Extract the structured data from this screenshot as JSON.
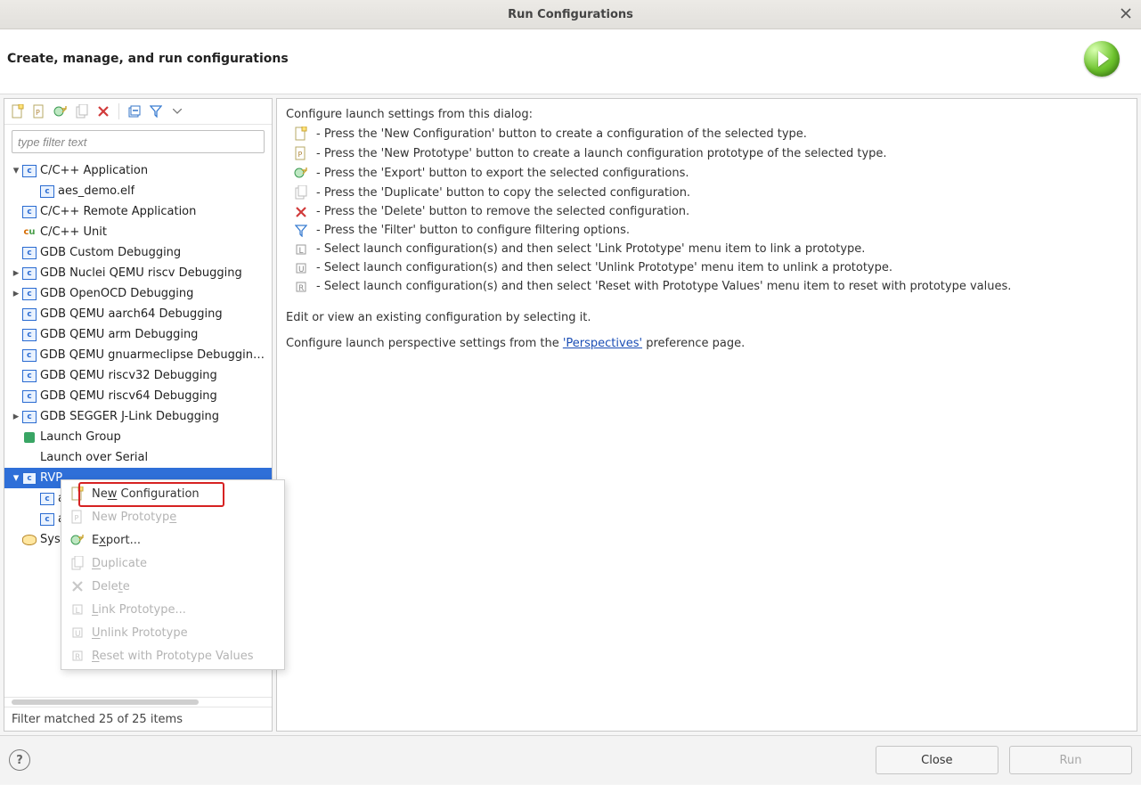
{
  "window": {
    "title": "Run Configurations"
  },
  "header": {
    "heading": "Create, manage, and run configurations"
  },
  "filter": {
    "placeholder": "type filter text"
  },
  "tree": {
    "items": [
      {
        "label": "C/C++ Application",
        "caret": "down",
        "icon": "c"
      },
      {
        "label": "aes_demo.elf",
        "indent": 1,
        "caret": "none",
        "icon": "c"
      },
      {
        "label": "C/C++ Remote Application",
        "caret": "none",
        "icon": "c"
      },
      {
        "label": "C/C++ Unit",
        "caret": "none",
        "icon": "cu"
      },
      {
        "label": "GDB Custom Debugging",
        "caret": "none",
        "icon": "c"
      },
      {
        "label": "GDB Nuclei QEMU riscv Debugging",
        "caret": "right",
        "icon": "c"
      },
      {
        "label": "GDB OpenOCD Debugging",
        "caret": "right",
        "icon": "c"
      },
      {
        "label": "GDB QEMU aarch64 Debugging",
        "caret": "none",
        "icon": "c"
      },
      {
        "label": "GDB QEMU arm Debugging",
        "caret": "none",
        "icon": "c"
      },
      {
        "label": "GDB QEMU gnuarmeclipse Debugging (D",
        "caret": "none",
        "icon": "c"
      },
      {
        "label": "GDB QEMU riscv32 Debugging",
        "caret": "none",
        "icon": "c"
      },
      {
        "label": "GDB QEMU riscv64 Debugging",
        "caret": "none",
        "icon": "c"
      },
      {
        "label": "GDB SEGGER J-Link Debugging",
        "caret": "right",
        "icon": "c"
      },
      {
        "label": "Launch Group",
        "caret": "none",
        "icon": "lg"
      },
      {
        "label": "Launch over Serial",
        "caret": "none",
        "icon": "none"
      },
      {
        "label": "RVP",
        "caret": "down",
        "icon": "c",
        "selected": true
      },
      {
        "label": "a",
        "indent": 1,
        "caret": "none",
        "icon": "c"
      },
      {
        "label": "a",
        "indent": 1,
        "caret": "none",
        "icon": "c"
      },
      {
        "label": "Syst",
        "caret": "none",
        "icon": "db"
      }
    ]
  },
  "status": {
    "text": "Filter matched 25 of 25 items"
  },
  "main": {
    "intro": "Configure launch settings from this dialog:",
    "hints": [
      {
        "icon": "new",
        "text": " - Press the 'New Configuration' button to create a configuration of the selected type."
      },
      {
        "icon": "proto",
        "text": " - Press the 'New Prototype' button to create a launch configuration prototype of the selected type."
      },
      {
        "icon": "export",
        "text": " - Press the 'Export' button to export the selected configurations."
      },
      {
        "icon": "duplicate",
        "text": " - Press the 'Duplicate' button to copy the selected configuration."
      },
      {
        "icon": "delete",
        "text": " - Press the 'Delete' button to remove the selected configuration."
      },
      {
        "icon": "filter",
        "text": " - Press the 'Filter' button to configure filtering options."
      },
      {
        "icon": "link",
        "text": " - Select launch configuration(s) and then select 'Link Prototype' menu item to link a prototype."
      },
      {
        "icon": "unlink",
        "text": " - Select launch configuration(s) and then select 'Unlink Prototype' menu item to unlink a prototype."
      },
      {
        "icon": "reset",
        "text": " - Select launch configuration(s) and then select 'Reset with Prototype Values' menu item to reset with prototype values."
      }
    ],
    "edit_line": "Edit or view an existing configuration by selecting it.",
    "persp_prefix": "Configure launch perspective settings from the ",
    "persp_link": "'Perspectives'",
    "persp_suffix": " preference page."
  },
  "context_menu": {
    "items": [
      {
        "key": "new_config",
        "pre": "Ne",
        "u": "w",
        "post": " Configuration",
        "icon": "new",
        "enabled": true,
        "highlight": true
      },
      {
        "key": "new_proto",
        "pre": "New Prototyp",
        "u": "e",
        "post": "",
        "icon": "proto",
        "enabled": false
      },
      {
        "key": "export",
        "pre": "E",
        "u": "x",
        "post": "port...",
        "icon": "export",
        "enabled": true
      },
      {
        "key": "duplicate",
        "pre": "",
        "u": "D",
        "post": "uplicate",
        "icon": "duplicate",
        "enabled": false
      },
      {
        "key": "delete",
        "pre": "Dele",
        "u": "t",
        "post": "e",
        "icon": "delete",
        "enabled": false
      },
      {
        "key": "link_proto",
        "pre": "",
        "u": "L",
        "post": "ink Prototype...",
        "icon": "link",
        "enabled": false
      },
      {
        "key": "unlink",
        "pre": "",
        "u": "U",
        "post": "nlink Prototype",
        "icon": "unlink",
        "enabled": false
      },
      {
        "key": "reset",
        "pre": "",
        "u": "R",
        "post": "eset with Prototype Values",
        "icon": "reset",
        "enabled": false
      }
    ]
  },
  "buttons": {
    "close": "Close",
    "run": "Run"
  }
}
